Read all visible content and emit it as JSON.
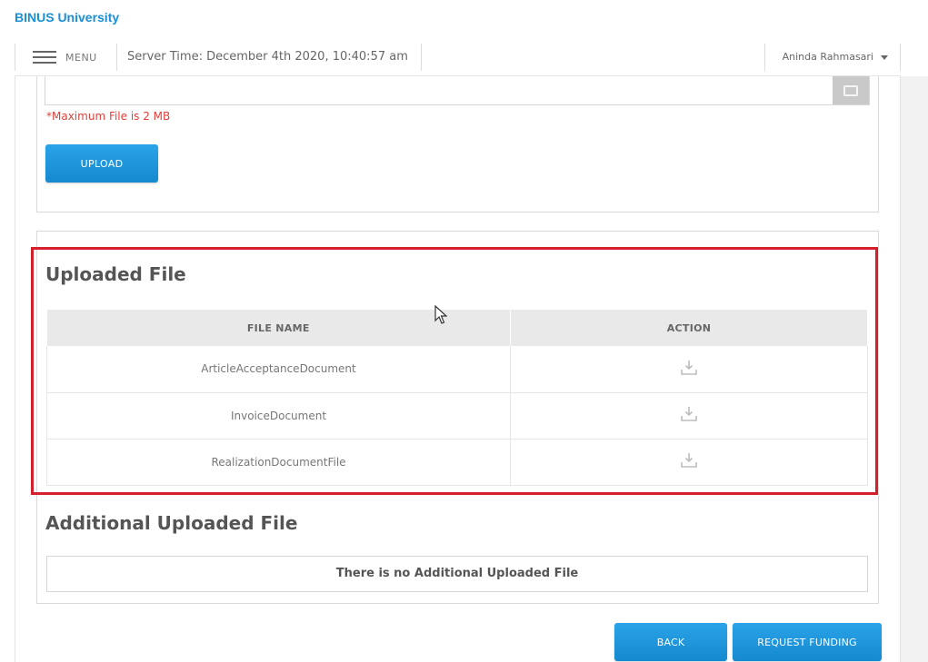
{
  "brand": "BINUS University",
  "topbar": {
    "menu_label": "MENU",
    "server_time": "Server Time: December 4th 2020, 10:40:57 am",
    "user_name": "Aninda Rahmasari"
  },
  "upload_section": {
    "max_file_note": "*Maximum File is 2 MB",
    "upload_label": "UPLOAD"
  },
  "uploaded": {
    "title": "Uploaded File",
    "headers": {
      "file_name": "FILE NAME",
      "action": "ACTION"
    },
    "rows": [
      {
        "file_name": "ArticleAcceptanceDocument",
        "action_icon": "download-icon"
      },
      {
        "file_name": "InvoiceDocument",
        "action_icon": "download-icon"
      },
      {
        "file_name": "RealizationDocumentFile",
        "action_icon": "download-icon"
      }
    ]
  },
  "additional": {
    "title": "Additional Uploaded File",
    "empty_message": "There is no Additional Uploaded File"
  },
  "actions": {
    "back_label": "BACK",
    "request_funding_label": "REQUEST FUNDING"
  },
  "colors": {
    "brand": "#1a8fd6",
    "primary_button": "#1e96dc",
    "warning_text": "#e0413a",
    "highlight_border": "#d4202b"
  }
}
